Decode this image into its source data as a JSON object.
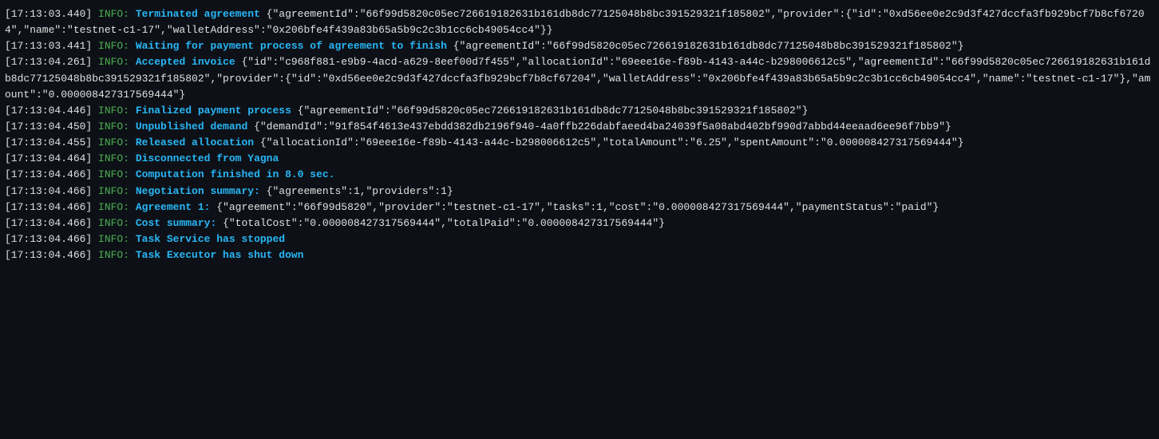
{
  "terminal": {
    "lines": [
      {
        "id": "line1",
        "timestamp": "[17:13:03.440]",
        "level": "INFO",
        "highlight": "Terminated agreement",
        "rest": " {\"agreementId\":\"66f99d5820c05ec726619182631b161db8dc77125048b8bc391529321f185802\",\"provider\":{\"id\":\"0xd56ee0e2c9d3f427dccfa3fb929bcf7b8cf67204\",\"name\":\"testnet-c1-17\",\"walletAddress\":\"0x206bfe4f439a83b65a5b9c2c3b1cc6cb49054cc4\"}}"
      },
      {
        "id": "line2",
        "timestamp": "[17:13:03.441]",
        "level": "INFO",
        "highlight": "Waiting for payment process of agreement to finish",
        "rest": " {\"agreementId\":\"66f99d5820c05ec726619182631b161db8dc77125048b8bc391529321f185802\"}"
      },
      {
        "id": "line3",
        "timestamp": "[17:13:04.261]",
        "level": "INFO",
        "highlight": "Accepted invoice",
        "rest": " {\"id\":\"c968f881-e9b9-4acd-a629-8eef00d7f455\",\"allocationId\":\"69eee16e-f89b-4143-a44c-b298006612c5\",\"agreementId\":\"66f99d5820c05ec726619182631b161db8dc77125048b8bc391529321f185802\",\"provider\":{\"id\":\"0xd56ee0e2c9d3f427dccfa3fb929bcf7b8cf67204\",\"walletAddress\":\"0x206bfe4f439a83b65a5b9c2c3b1cc6cb49054cc4\",\"name\":\"testnet-c1-17\"},\"amount\":\"0.000008427317569444\"}"
      },
      {
        "id": "line4",
        "timestamp": "[17:13:04.446]",
        "level": "INFO",
        "highlight": "Finalized payment process",
        "rest": " {\"agreementId\":\"66f99d5820c05ec726619182631b161db8dc77125048b8bc391529321f185802\"}"
      },
      {
        "id": "line5",
        "timestamp": "[17:13:04.450]",
        "level": "INFO",
        "highlight": "Unpublished demand",
        "rest": " {\"demandId\":\"91f854f4613e437ebdd382db2196f940-4a0ffb226dabfaeed4ba24039f5a08abd402bf990d7abbd44eeaad6ee96f7bb9\"}"
      },
      {
        "id": "line6",
        "timestamp": "[17:13:04.455]",
        "level": "INFO",
        "highlight": "Released allocation",
        "rest": " {\"allocationId\":\"69eee16e-f89b-4143-a44c-b298006612c5\",\"totalAmount\":\"6.25\",\"spentAmount\":\"0.000008427317569444\"}"
      },
      {
        "id": "line7",
        "timestamp": "[17:13:04.464]",
        "level": "INFO",
        "highlight": "Disconnected from Yagna",
        "rest": ""
      },
      {
        "id": "line8",
        "timestamp": "[17:13:04.466]",
        "level": "INFO",
        "highlight": "Computation finished in 8.0 sec.",
        "rest": ""
      },
      {
        "id": "line9",
        "timestamp": "[17:13:04.466]",
        "level": "INFO",
        "highlight": "Negotiation summary:",
        "rest": " {\"agreements\":1,\"providers\":1}"
      },
      {
        "id": "line10",
        "timestamp": "[17:13:04.466]",
        "level": "INFO",
        "highlight": "Agreement 1:",
        "rest": " {\"agreement\":\"66f99d5820\",\"provider\":\"testnet-c1-17\",\"tasks\":1,\"cost\":\"0.000008427317569444\",\"paymentStatus\":\"paid\"}"
      },
      {
        "id": "line11",
        "timestamp": "[17:13:04.466]",
        "level": "INFO",
        "highlight": "Cost summary:",
        "rest": " {\"totalCost\":\"0.000008427317569444\",\"totalPaid\":\"0.000008427317569444\"}"
      },
      {
        "id": "line12",
        "timestamp": "[17:13:04.466]",
        "level": "INFO",
        "highlight": "Task Service has stopped",
        "rest": ""
      },
      {
        "id": "line13",
        "timestamp": "[17:13:04.466]",
        "level": "INFO",
        "highlight": "Task Executor has shut down",
        "rest": ""
      }
    ]
  }
}
